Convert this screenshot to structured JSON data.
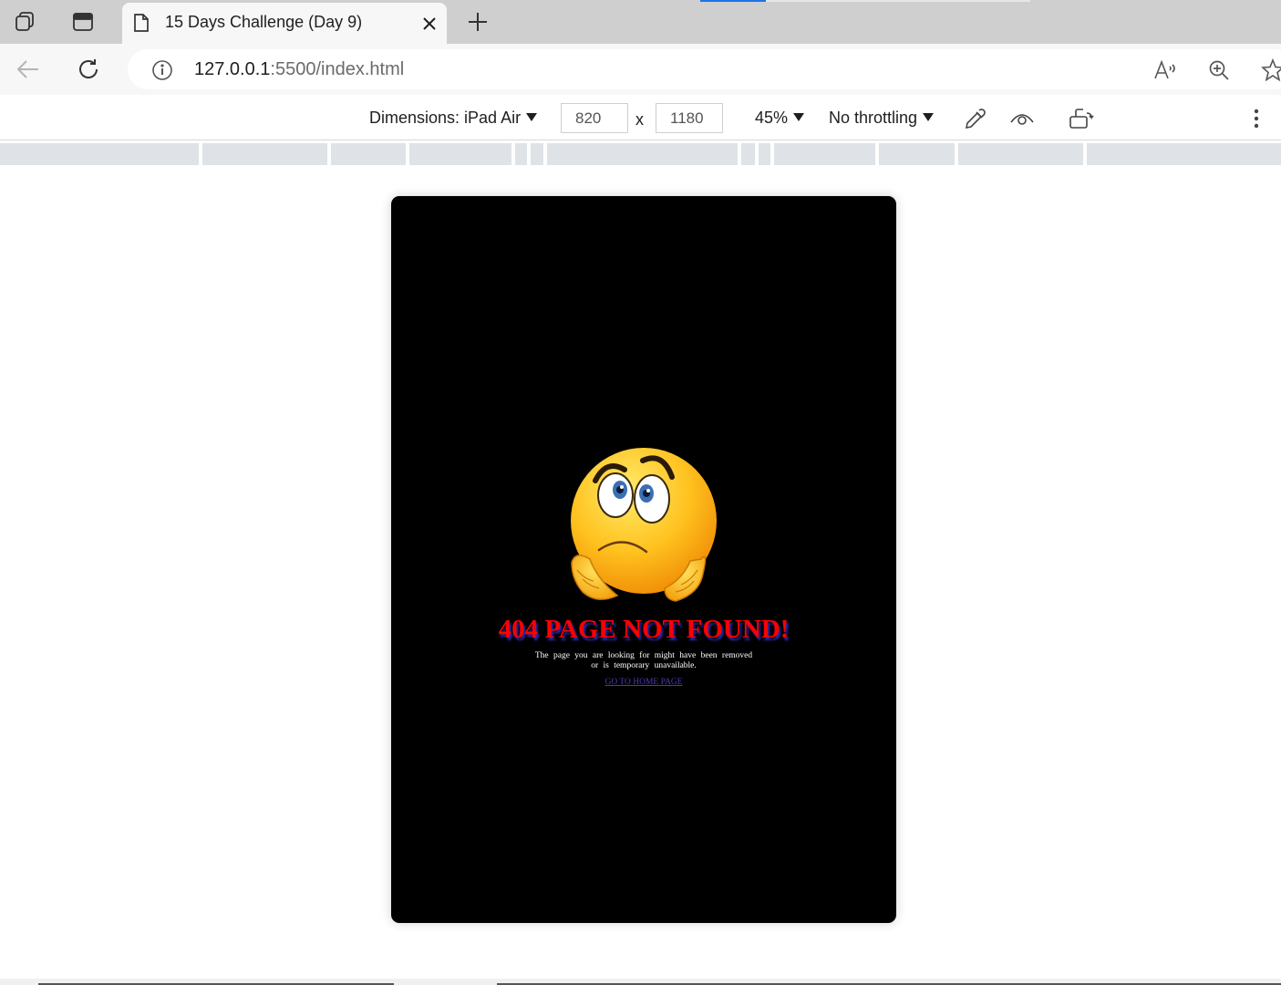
{
  "browser": {
    "tab": {
      "title": "15 Days Challenge (Day 9)"
    },
    "address": {
      "host": "127.0.0.1",
      "path": ":5500/index.html"
    }
  },
  "device_toolbar": {
    "dimensions_label": "Dimensions: iPad Air",
    "width": "820",
    "x_separator": "x",
    "height": "1180",
    "zoom": "45%",
    "throttling": "No throttling"
  },
  "page": {
    "headline": "404 PAGE NOT FOUND!",
    "message_line1": "The page you are looking for might have been removed",
    "message_line2": "or is temporary unavailable.",
    "home_link": "GO TO HOME PAGE"
  },
  "colors": {
    "headline": "#ff0000",
    "headline_shadow": "#2a2aa8",
    "device_background": "#000000",
    "link": "#4a3ab5",
    "accent": "#1a73e8"
  },
  "icons": {
    "workspaces": "workspaces-icon",
    "tab_actions": "tab-actions-icon",
    "page": "page-icon",
    "close": "close-icon",
    "new_tab": "plus-icon",
    "back": "back-arrow-icon",
    "refresh": "refresh-icon",
    "info": "info-icon",
    "read_aloud": "read-aloud-icon",
    "zoom": "zoom-in-icon",
    "favorite": "star-icon",
    "eyedropper": "eyedropper-icon",
    "vision": "eye-icon",
    "rotate": "rotate-device-icon",
    "more": "more-vertical-icon",
    "emoji": "worried-face-emoji"
  }
}
